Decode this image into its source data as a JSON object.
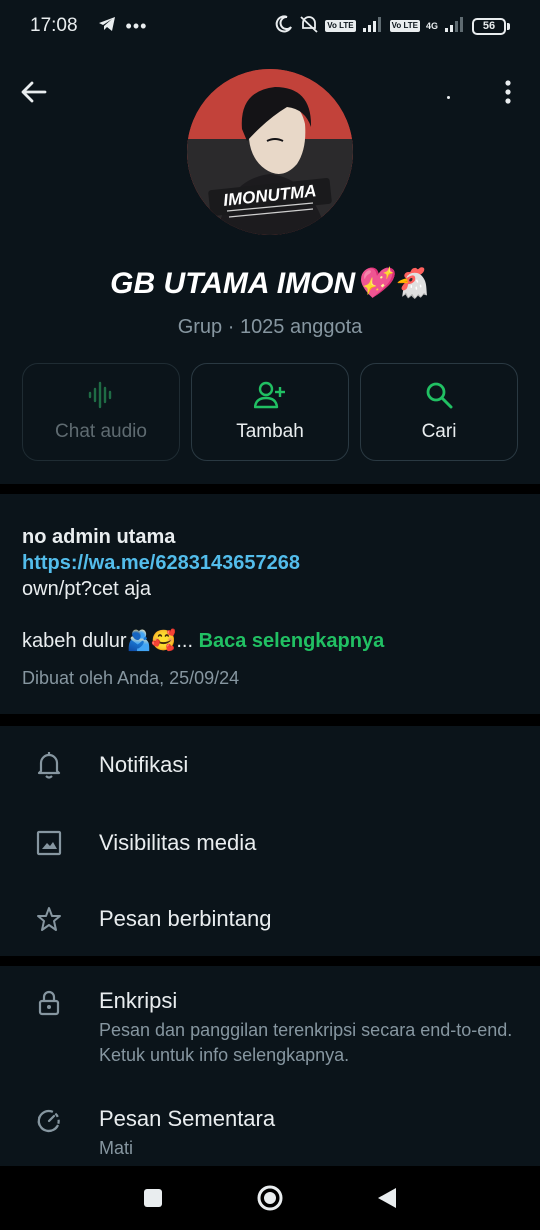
{
  "status_bar": {
    "time": "17:08",
    "chip_volte1": "Vo LTE",
    "chip_volte2": "Vo LTE",
    "network": "4G",
    "battery": "56"
  },
  "group": {
    "name": "GB UTAMA IMON💖🐔",
    "subtitle": "Grup · 1025 anggota",
    "avatar_text": "IMONUTMA"
  },
  "actions": [
    {
      "label": "Chat audio",
      "icon": "audio-wave-icon",
      "enabled": false
    },
    {
      "label": "Tambah",
      "icon": "add-person-icon",
      "enabled": true
    },
    {
      "label": "Cari",
      "icon": "search-icon",
      "enabled": true
    }
  ],
  "description": {
    "line1": "no admin utama",
    "link": "https://wa.me/6283143657268",
    "line3": "own/pt?cet aja",
    "line4": "kabeh dulur🫂🥰...",
    "read_more": "Baca selengkapnya",
    "created": "Dibuat oleh Anda, 25/09/24"
  },
  "settings": [
    {
      "label": "Notifikasi",
      "icon": "bell-icon"
    },
    {
      "label": "Visibilitas media",
      "icon": "image-icon"
    },
    {
      "label": "Pesan berbintang",
      "icon": "star-icon"
    }
  ],
  "security": [
    {
      "label": "Enkripsi",
      "sub": "Pesan dan panggilan terenkripsi secara end-to-end. Ketuk untuk info selengkapnya.",
      "icon": "lock-icon"
    },
    {
      "label": "Pesan Sementara",
      "sub": "Mati",
      "icon": "timer-icon"
    }
  ],
  "colors": {
    "background": "#0b141a",
    "accent_green": "#21c063",
    "link_blue": "#53bdeb",
    "muted": "#8696a0"
  }
}
